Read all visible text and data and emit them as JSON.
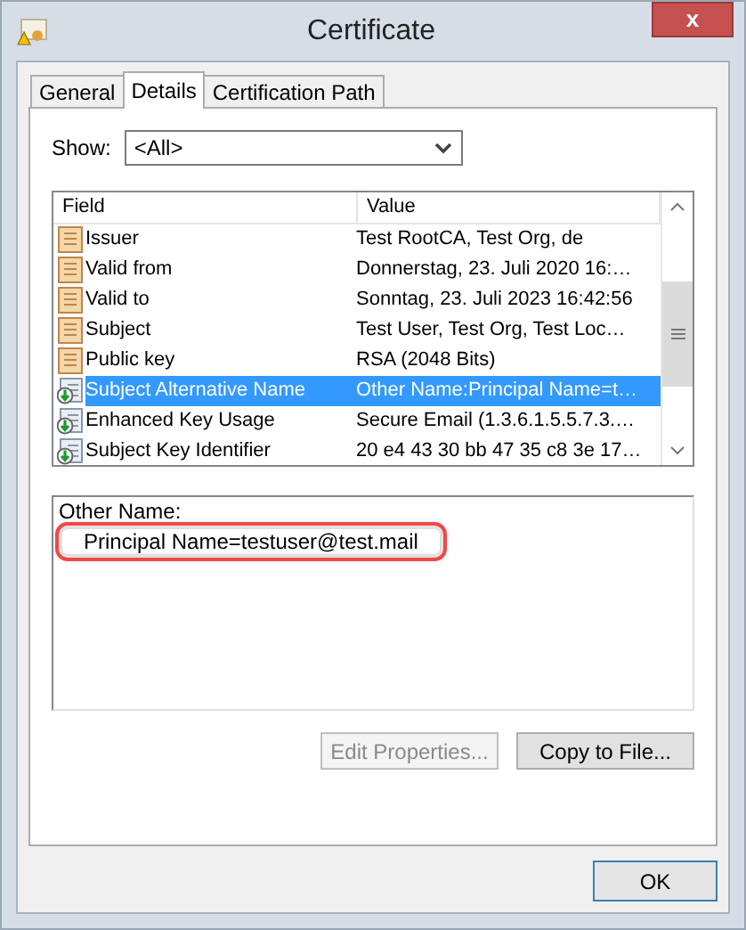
{
  "window": {
    "title": "Certificate",
    "close": "x"
  },
  "tabs": [
    {
      "label": "General",
      "selected": false
    },
    {
      "label": "Details",
      "selected": true
    },
    {
      "label": "Certification Path",
      "selected": false
    }
  ],
  "show": {
    "label": "Show:",
    "value": "<All>"
  },
  "table": {
    "columns": [
      "Field",
      "Value"
    ],
    "rows": [
      {
        "kind": "property",
        "field": "Issuer",
        "value": "Test RootCA, Test Org, de",
        "selected": false
      },
      {
        "kind": "property",
        "field": "Valid from",
        "value": "Donnerstag, 23. Juli 2020 16:…",
        "selected": false
      },
      {
        "kind": "property",
        "field": "Valid to",
        "value": "Sonntag, 23. Juli 2023 16:42:56",
        "selected": false
      },
      {
        "kind": "property",
        "field": "Subject",
        "value": "Test User, Test Org, Test Loc…",
        "selected": false
      },
      {
        "kind": "property",
        "field": "Public key",
        "value": "RSA (2048 Bits)",
        "selected": false
      },
      {
        "kind": "extension",
        "field": "Subject Alternative Name",
        "value": "Other Name:Principal Name=t…",
        "selected": true
      },
      {
        "kind": "extension",
        "field": "Enhanced Key Usage",
        "value": "Secure Email (1.3.6.1.5.5.7.3.…",
        "selected": false
      },
      {
        "kind": "extension",
        "field": "Subject Key Identifier",
        "value": "20 e4 43 30 bb 47 35 c8 3e 17…",
        "selected": false
      }
    ]
  },
  "detail": [
    {
      "text": "Other Name:",
      "indented": false,
      "highlighted": false
    },
    {
      "text": "Principal Name=testuser@test.mail",
      "indented": true,
      "highlighted": true
    }
  ],
  "buttons": [
    {
      "label": "Edit Properties...",
      "disabled": true
    },
    {
      "label": "Copy to File...",
      "disabled": false
    }
  ],
  "footer_button": "OK"
}
